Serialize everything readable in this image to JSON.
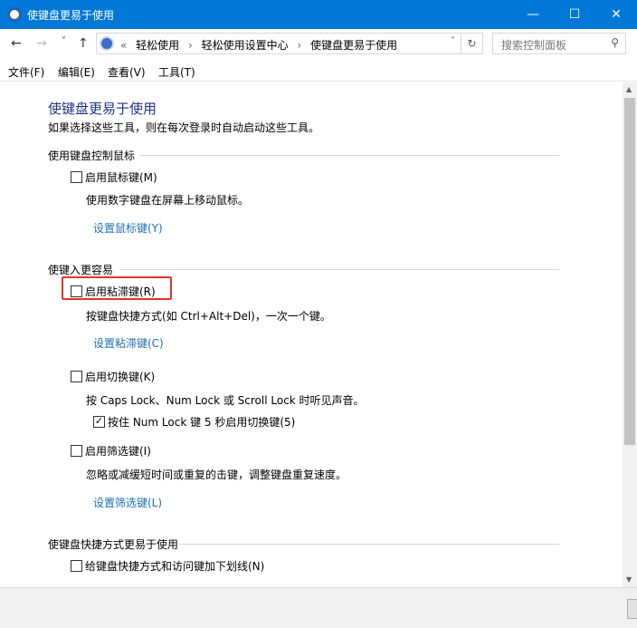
{
  "window": {
    "title": "使键盘更易于使用",
    "minimize": "—",
    "maximize": "☐",
    "close": "✕"
  },
  "nav": {
    "back": "←",
    "forward": "→",
    "recent": "˅",
    "up": "↑"
  },
  "address": {
    "overflow": "«",
    "crumbs": [
      "轻松使用",
      "轻松使用设置中心",
      "使键盘更易于使用"
    ],
    "separator": "›",
    "dropdown": "˅",
    "refresh": "↻"
  },
  "search": {
    "placeholder": "搜索控制面板",
    "icon": "⚲"
  },
  "menu": [
    "文件(F)",
    "编辑(E)",
    "查看(V)",
    "工具(T)"
  ],
  "page": {
    "title": "使键盘更易于使用",
    "subtitle": "如果选择这些工具，则在每次登录时自动启动这些工具。"
  },
  "sections": {
    "mouse": {
      "header": "使用键盘控制鼠标",
      "option": "启用鼠标键(M)",
      "desc": "使用数字键盘在屏幕上移动鼠标。",
      "link": "设置鼠标键(Y)"
    },
    "typing": {
      "header": "使键入更容易",
      "sticky": "启用粘滞键(R)",
      "sticky_desc": "按键盘快捷方式(如 Ctrl+Alt+Del)，一次一个键。",
      "sticky_link": "设置粘滞键(C)",
      "toggle": "启用切换键(K)",
      "toggle_desc": "按 Caps Lock、Num Lock 或 Scroll Lock 时听见声音。",
      "toggle_sub": "按住 Num Lock 键 5 秒启用切换键(5)",
      "filter": "启用筛选键(I)",
      "filter_desc": "忽略或减缓短时间或重复的击键，调整键盘重复速度。",
      "filter_link": "设置筛选键(L)"
    },
    "shortcuts": {
      "header": "使键盘快捷方式更易于使用",
      "option": "给键盘快捷方式和访问键加下划线(N)"
    }
  },
  "checked": {
    "mouse": false,
    "sticky": false,
    "toggle": false,
    "toggle_sub": true,
    "filter": false,
    "underline": false
  },
  "colors": {
    "titlebar": "#0078d7",
    "link": "#1e6fb5",
    "highlight": "#e0342f",
    "heading": "#1e3287"
  }
}
